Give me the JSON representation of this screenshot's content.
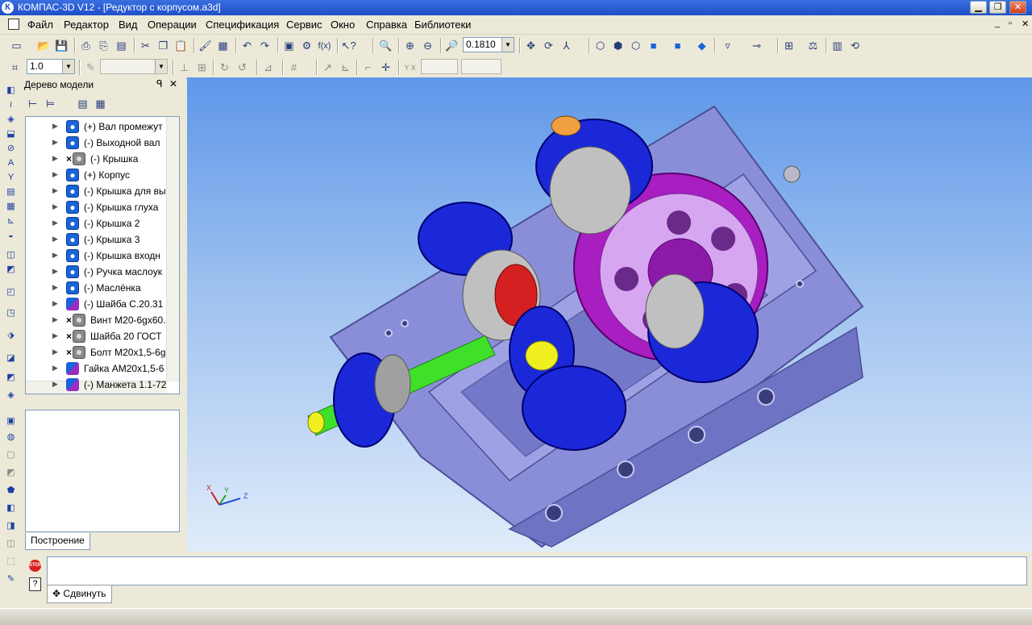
{
  "window": {
    "title": "КОМПАС-3D V12 - [Редуктор с корпусом.a3d]",
    "app_icon": "К",
    "minimize": "▁",
    "restore": "❐",
    "close": "✕"
  },
  "menu": {
    "items": [
      "Файл",
      "Редактор",
      "Вид",
      "Операции",
      "Спецификация",
      "Сервис",
      "Окно",
      "Справка",
      "Библиотеки"
    ],
    "mdi_min": "_",
    "mdi_restore": "▫",
    "mdi_close": "✕"
  },
  "toolbar1": {
    "zoom_value": "0.1810"
  },
  "toolbar2": {
    "step_value": "1.0"
  },
  "tree_panel": {
    "title": "Дерево модели",
    "pin": "ᑫ",
    "close": "✕",
    "items": [
      {
        "label": "(+) Вал промежут",
        "icon": "part-icon",
        "excluded": false
      },
      {
        "label": "(-) Выходной вал",
        "icon": "part-icon",
        "excluded": false
      },
      {
        "label": "(-) Крышка",
        "icon": "part-grey-icon",
        "excluded": true
      },
      {
        "label": "(+) Корпус",
        "icon": "part-icon",
        "excluded": false
      },
      {
        "label": "(-) Крышка для вы",
        "icon": "part-icon",
        "excluded": false
      },
      {
        "label": "(-) Крышка  глуха",
        "icon": "part-icon",
        "excluded": false
      },
      {
        "label": "(-) Крышка 2",
        "icon": "part-icon",
        "excluded": false
      },
      {
        "label": "(-) Крышка 3",
        "icon": "part-icon",
        "excluded": false
      },
      {
        "label": "(-) Крышка входн",
        "icon": "part-icon",
        "excluded": false
      },
      {
        "label": "(-) Ручка маслоук",
        "icon": "part-icon",
        "excluded": false
      },
      {
        "label": "(-) Маслёнка",
        "icon": "part-icon",
        "excluded": false
      },
      {
        "label": "(-) Шайба С.20.31",
        "icon": "standard-part-icon",
        "excluded": false
      },
      {
        "label": "Винт М20-6gx60.",
        "icon": "part-grey-icon",
        "excluded": true
      },
      {
        "label": "Шайба 20 ГОСТ",
        "icon": "part-grey-icon",
        "excluded": true
      },
      {
        "label": "Болт М20х1,5-6g",
        "icon": "part-grey-icon",
        "excluded": true
      },
      {
        "label": "Гайка АМ20х1,5-6",
        "icon": "standard-part-icon",
        "excluded": false
      },
      {
        "label": "(-) Манжета 1.1-72",
        "icon": "standard-part-icon",
        "excluded": false
      }
    ],
    "tab_label": "Построение"
  },
  "axes": {
    "x": "X",
    "y": "Y",
    "z": "Z"
  },
  "bottom": {
    "stop_label": "STOP",
    "help_label": "?",
    "move_button": "Сдвинуть"
  },
  "colors": {
    "titlebar": "#2457d2",
    "viewport_top": "#5f97e9",
    "housing": "#8c8fd6",
    "gear": "#a81ec0",
    "cover": "#1a28d8",
    "shaft": "#3fe02a"
  }
}
